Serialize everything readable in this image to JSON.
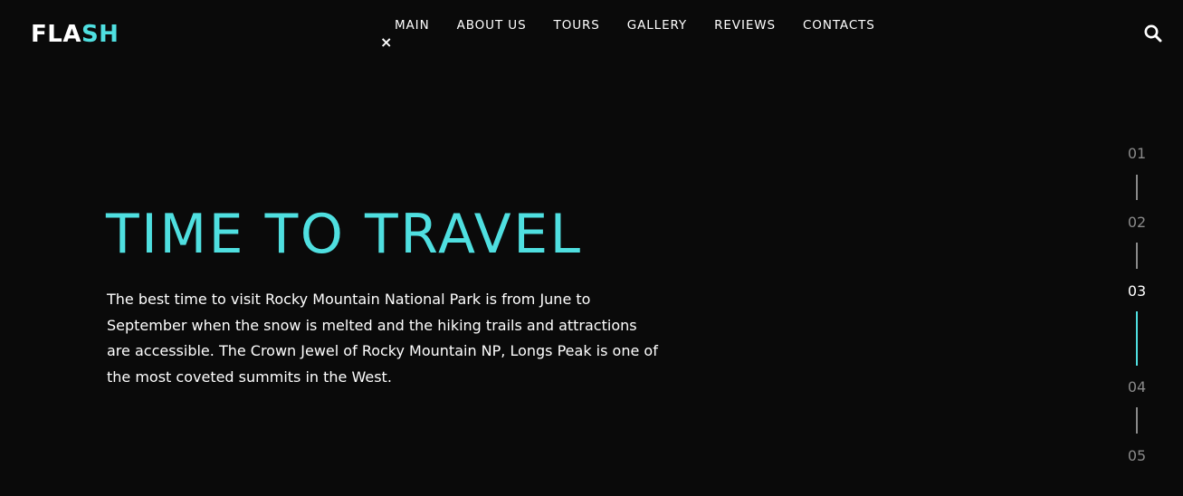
{
  "header": {
    "logo_part1": "FLA",
    "logo_part2": "SH",
    "nav": [
      "MAIN",
      "ABOUT US",
      "TOURS",
      "GALLERY",
      "REVIEWS",
      "CONTACTS"
    ],
    "close_glyph": "×",
    "search_icon": "search-icon"
  },
  "hero": {
    "title": "TIME TO TRAVEL",
    "text": "The best time to visit Rocky Mountain National Park is from June to September when the snow is melted and the hiking trails and attractions are accessible. The Crown Jewel of Rocky Mountain NP, Longs Peak is one of the most coveted summits in the West."
  },
  "pager": {
    "items": [
      "01",
      "02",
      "03",
      "04",
      "05"
    ],
    "active_index": 2
  },
  "colors": {
    "background": "#0a0a0a",
    "accent": "#4fdfe0",
    "text": "#ffffff",
    "muted": "#8a8a8a"
  }
}
